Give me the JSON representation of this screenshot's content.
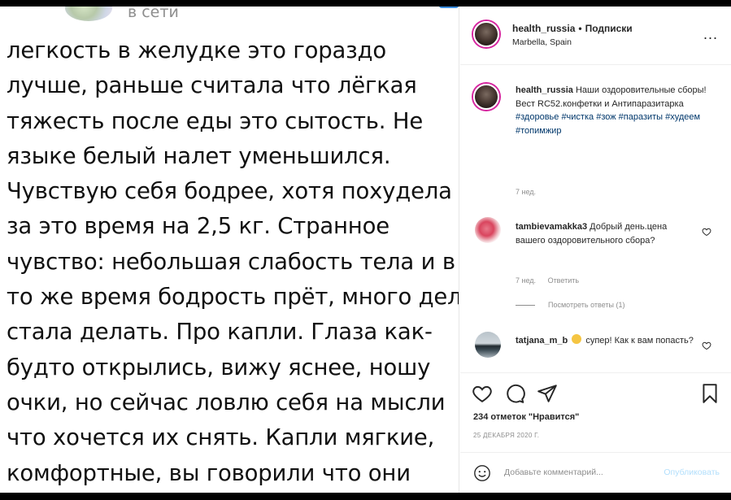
{
  "photo": {
    "status": "в сети",
    "lines": [
      "легкость в желудке это гораздо",
      "лучше, раньше считала что лёгкая",
      "тяжесть после еды это сытость. Не",
      "языке белый налет уменьшился.",
      "Чувствую себя бодрее, хотя похудела",
      "за это время на 2,5 кг. Странное",
      "чувство: небольшая слабость тела и в",
      "то же время бодрость прёт, много дел",
      "стала делать. Про капли. Глаза как-",
      "будто открылись, вижу яснее, ношу",
      "очки, но сейчас ловлю себя на мысли",
      "что хочется их снять. Капли мягкие,",
      "комфортные, вы говорили что они"
    ]
  },
  "header": {
    "username": "health_russia",
    "dot": "•",
    "follow": "Подписки",
    "location": "Marbella, Spain",
    "more": "..."
  },
  "caption": {
    "username": "health_russia",
    "text": "Наши оздоровительные сборы! Вест RC52.конфетки и Антипаразитарка",
    "hashtags": "#здоровье #чистка #зож #паразиты #худеем #топимжир",
    "time": "7 нед."
  },
  "comments": [
    {
      "username": "tambievamakka3",
      "text": "Добрый день.цена вашего оздоровительного сбора?",
      "time": "7 нед.",
      "reply": "Ответить",
      "view_replies": "Посмотреть ответы (1)"
    },
    {
      "username": "tatjana_m_b",
      "text_before": "",
      "text_after": "супер! Как к вам попасть?"
    }
  ],
  "actions": {
    "likes": "234 отметок \"Нравится\"",
    "date": "25 ДЕКАБРЯ 2020 Г."
  },
  "add_comment": {
    "placeholder": "Добавьте комментарий...",
    "publish": "Опубликовать"
  }
}
